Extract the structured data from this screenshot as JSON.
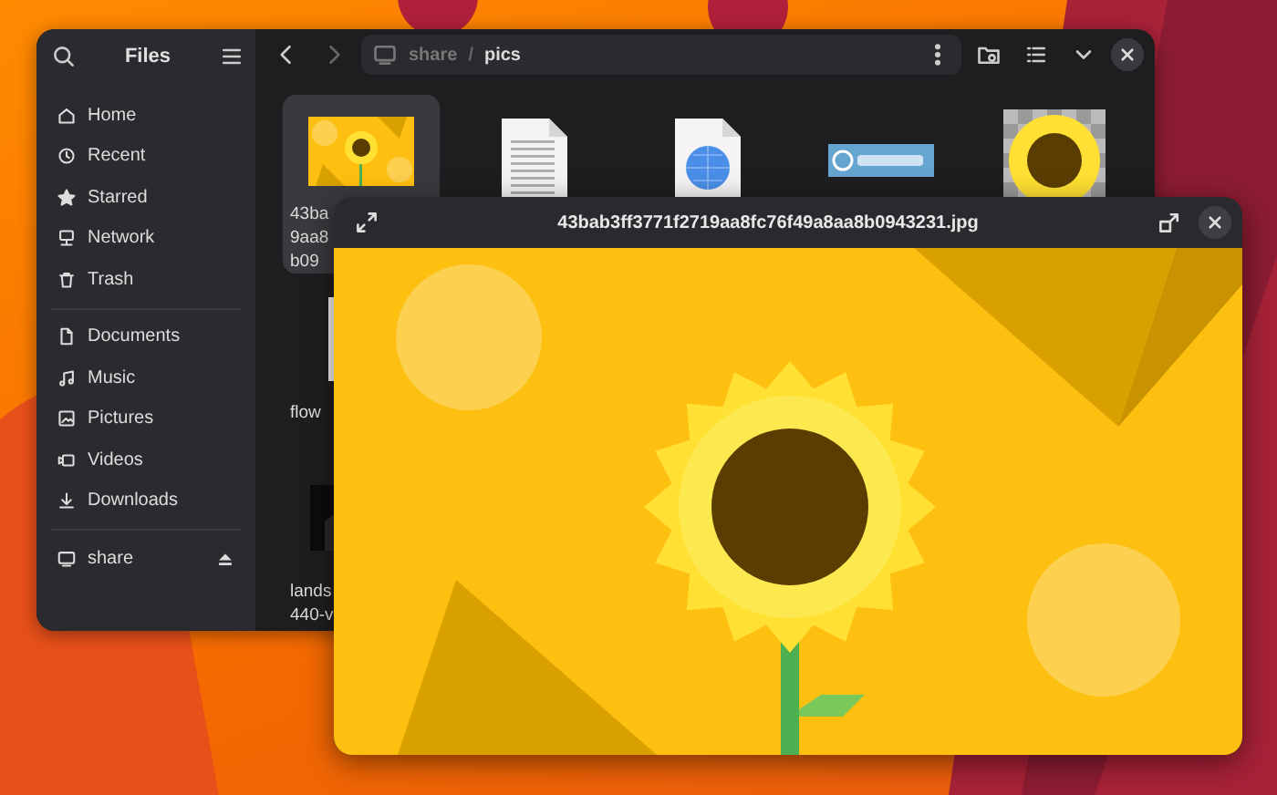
{
  "files_window": {
    "title": "Files",
    "places": [
      {
        "label": "Home",
        "kind": "home"
      },
      {
        "label": "Recent",
        "kind": "recent"
      },
      {
        "label": "Starred",
        "kind": "starred"
      },
      {
        "label": "Network",
        "kind": "network"
      },
      {
        "label": "Trash",
        "kind": "trash"
      }
    ],
    "folders": [
      {
        "label": "Documents",
        "kind": "document"
      },
      {
        "label": "Music",
        "kind": "music"
      },
      {
        "label": "Pictures",
        "kind": "pictures"
      },
      {
        "label": "Videos",
        "kind": "videos"
      },
      {
        "label": "Downloads",
        "kind": "downloads"
      }
    ],
    "devices": [
      {
        "label": "share",
        "kind": "drive"
      }
    ],
    "path": [
      "share",
      "pics"
    ],
    "path_separator": "/",
    "files": [
      {
        "kind": "sunflower-photo",
        "selected": true,
        "label_lines": [
          "43ba",
          "9aa8",
          "b09"
        ]
      },
      {
        "kind": "text",
        "selected": false
      },
      {
        "kind": "web",
        "selected": false
      },
      {
        "kind": "logo-image",
        "selected": false
      },
      {
        "kind": "sunflower-transparent",
        "selected": false
      },
      {
        "kind": "document",
        "selected": false,
        "label_lines": [
          "flow"
        ]
      },
      {
        "kind": "dark-photo",
        "selected": false,
        "label_lines": [
          "lands",
          "440-v"
        ]
      }
    ]
  },
  "viewer": {
    "title": "43bab3ff3771f2719aa8fc76f49a8aa8b0943231.jpg"
  }
}
